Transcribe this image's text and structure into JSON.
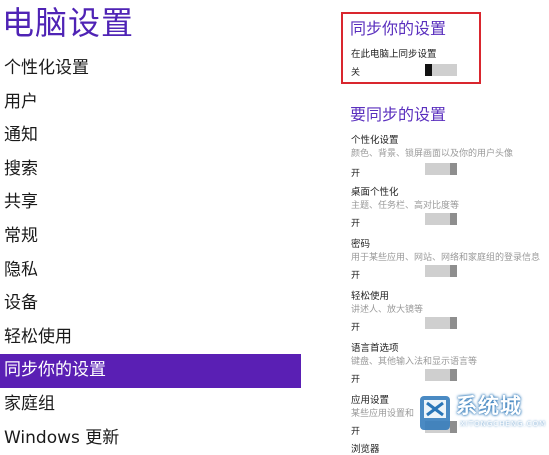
{
  "left": {
    "title": "电脑设置",
    "nav": [
      "个性化设置",
      "用户",
      "通知",
      "搜索",
      "共享",
      "常规",
      "隐私",
      "设备",
      "轻松使用",
      "同步你的设置",
      "家庭组",
      "Windows 更新"
    ],
    "active_index": 9
  },
  "sync": {
    "heading": "同步你的设置",
    "setting_title": "在此电脑上同步设置",
    "state": "关",
    "toggle_on": false
  },
  "what_to_sync": {
    "heading": "要同步的设置",
    "items": [
      {
        "title": "个性化设置",
        "desc": "颜色、背景、锁屏画面以及你的用户头像",
        "state": "开"
      },
      {
        "title": "桌面个性化",
        "desc": "主题、任务栏、高对比度等",
        "state": "开"
      },
      {
        "title": "密码",
        "desc": "用于某些应用、网站、网络和家庭组的登录信息",
        "state": "开"
      },
      {
        "title": "轻松使用",
        "desc": "讲述人、放大镜等",
        "state": "开"
      },
      {
        "title": "语言首选项",
        "desc": "键盘、其他输入法和显示语言等",
        "state": "开"
      },
      {
        "title": "应用设置",
        "desc": "某些应用设置和",
        "state": "开"
      },
      {
        "title": "浏览器",
        "desc": "",
        "state": ""
      }
    ]
  },
  "watermark": {
    "text": "系统城",
    "sub": "XITONGCHENG.COM"
  },
  "colors": {
    "accent": "#5a1fb4",
    "heading": "#5a2fbe",
    "highlight_border": "#d9262e"
  }
}
